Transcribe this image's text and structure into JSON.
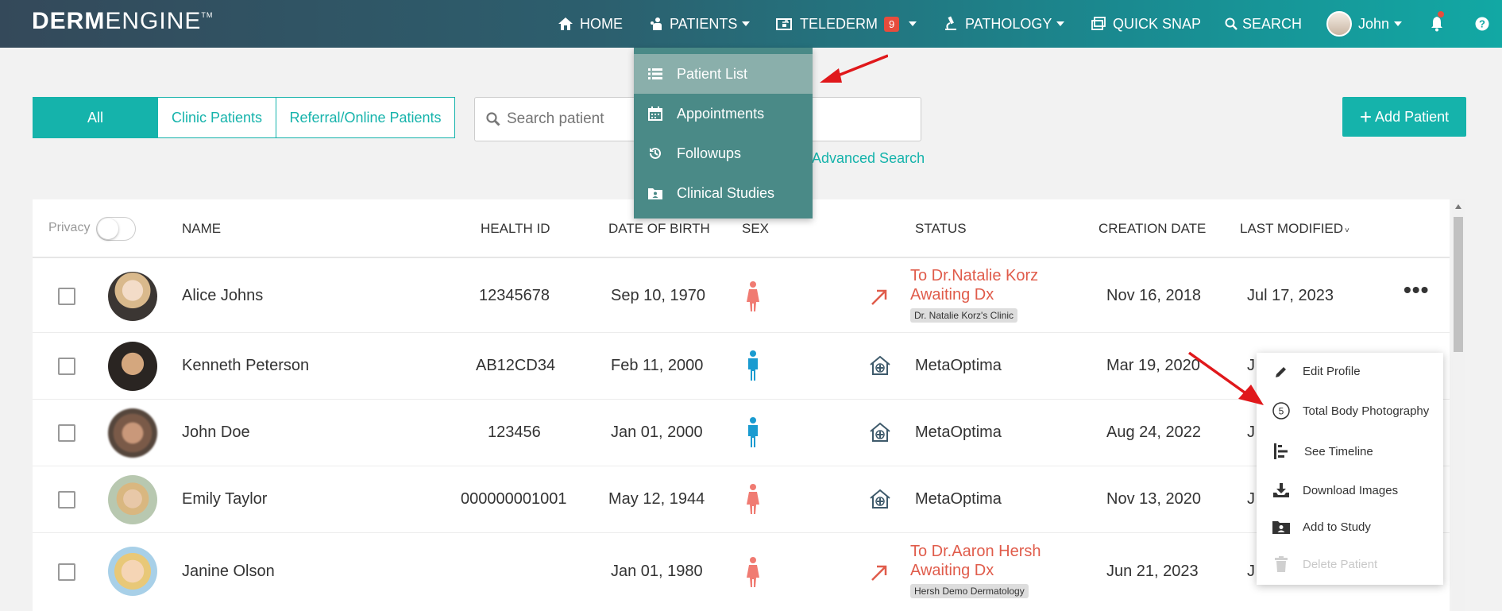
{
  "brand": {
    "bold": "DERM",
    "thin": "ENGINE",
    "tm": "TM"
  },
  "nav": {
    "home": "HOME",
    "patients": "PATIENTS",
    "telederm": "TELEDERM",
    "telederm_badge": "9",
    "pathology": "PATHOLOGY",
    "quick_snap": "QUICK SNAP",
    "search": "SEARCH",
    "user": "John"
  },
  "filters": {
    "all": "All",
    "clinic": "Clinic Patients",
    "referral": "Referral/Online Patients"
  },
  "search": {
    "placeholder": "Search patient",
    "advanced": "Advanced Search"
  },
  "add_patient": "Add Patient",
  "patients_menu": {
    "items": [
      "Patient List",
      "Appointments",
      "Followups",
      "Clinical Studies"
    ]
  },
  "table": {
    "privacy": "Privacy",
    "headers": {
      "name": "NAME",
      "health_id": "HEALTH ID",
      "dob": "DATE OF BIRTH",
      "sex": "SEX",
      "status": "STATUS",
      "created": "CREATION DATE",
      "modified": "LAST MODIFIED"
    },
    "rows": [
      {
        "name": "Alice Johns",
        "health_id": "12345678",
        "dob": "Sep 10, 1970",
        "sex": "female",
        "status_line1": "To Dr.Natalie Korz",
        "status_line2": "Awaiting Dx",
        "clinic": "Dr. Natalie Korz's Clinic",
        "created": "Nov 16, 2018",
        "modified": "Jul 17, 2023"
      },
      {
        "name": "Kenneth Peterson",
        "health_id": "AB12CD34",
        "dob": "Feb 11, 2000",
        "sex": "male",
        "status": "MetaOptima",
        "created": "Mar 19, 2020",
        "modified": "J"
      },
      {
        "name": "John Doe",
        "health_id": "123456",
        "dob": "Jan 01, 2000",
        "sex": "male",
        "status": "MetaOptima",
        "created": "Aug 24, 2022",
        "modified": "J"
      },
      {
        "name": "Emily Taylor",
        "health_id": "000000001001",
        "dob": "May 12, 1944",
        "sex": "female",
        "status": "MetaOptima",
        "created": "Nov 13, 2020",
        "modified": "J"
      },
      {
        "name": "Janine Olson",
        "health_id": "",
        "dob": "Jan 01, 1980",
        "sex": "female",
        "status_line1": "To Dr.Aaron Hersh",
        "status_line2": "Awaiting Dx",
        "clinic": "Hersh Demo Dermatology",
        "created": "Jun 21, 2023",
        "modified": "J"
      }
    ]
  },
  "row_menu": {
    "edit": "Edit Profile",
    "tbp": "Total Body Photography",
    "tbp_count": "5",
    "timeline": "See Timeline",
    "download": "Download Images",
    "study": "Add to Study",
    "delete": "Delete Patient"
  },
  "colors": {
    "accent": "#15b3ab",
    "status_red": "#e05c4b",
    "male": "#1a9bd0",
    "female": "#f07b72",
    "arrow": "#e0181b"
  }
}
